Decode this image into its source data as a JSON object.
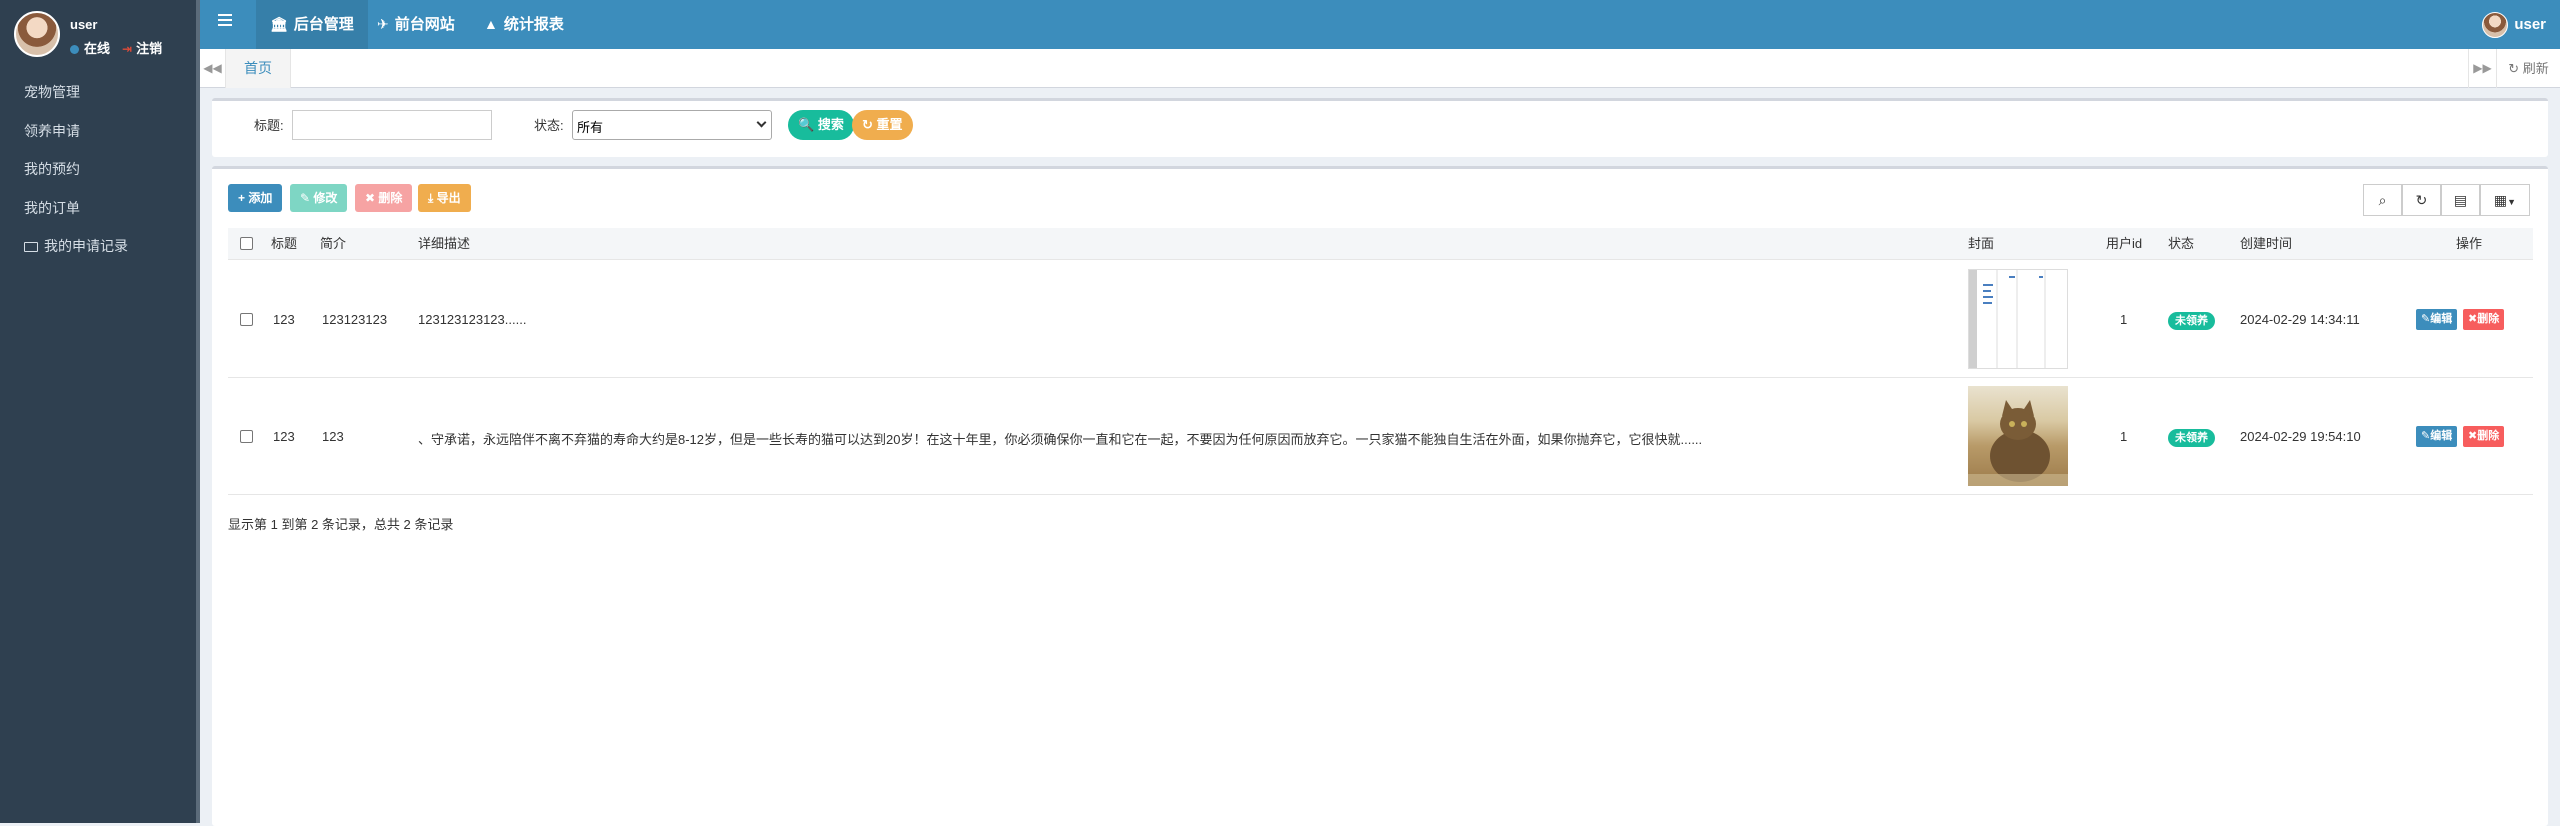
{
  "sidebar": {
    "user_name": "user",
    "online_label": "在线",
    "logout_label": "注销",
    "items": [
      {
        "label": "宠物管理"
      },
      {
        "label": "领养申请"
      },
      {
        "label": "我的预约"
      },
      {
        "label": "我的订单"
      },
      {
        "label": "我的申请记录"
      }
    ]
  },
  "topbar": {
    "nav": [
      {
        "label": "后台管理",
        "icon": "bank-icon"
      },
      {
        "label": "前台网站",
        "icon": "paper-plane-icon"
      },
      {
        "label": "统计报表",
        "icon": "area-chart-icon"
      }
    ],
    "user_name": "user"
  },
  "tabs": {
    "home": "首页",
    "refresh": "刷新"
  },
  "search": {
    "title_label": "标题:",
    "title_value": "",
    "status_label": "状态:",
    "status_value": "所有",
    "search_btn": "搜索",
    "reset_btn": "重置"
  },
  "toolbar": {
    "add": "添加",
    "edit": "修改",
    "delete": "删除",
    "export": "导出"
  },
  "table": {
    "columns": [
      "标题",
      "简介",
      "详细描述",
      "封面",
      "用户id",
      "状态",
      "创建时间",
      "操作"
    ],
    "rows": [
      {
        "title": "123",
        "intro": "123123123",
        "detail": "123123123123......",
        "user_id": "1",
        "status": "未领养",
        "created": "2024-02-29 14:34:11",
        "edit": "编辑",
        "delete": "删除"
      },
      {
        "title": "123",
        "intro": "123",
        "detail": "、守承诺，永远陪伴不离不弃猫的寿命大约是8-12岁，但是一些长寿的猫可以达到20岁！在这十年里，你必须确保你一直和它在一起，不要因为任何原因而放弃它。一只家猫不能独自生活在外面，如果你抛弃它，它很快就......",
        "user_id": "1",
        "status": "未领养",
        "created": "2024-02-29 19:54:10",
        "edit": "编辑",
        "delete": "删除"
      }
    ],
    "footer": "显示第 1 到第 2 条记录，总共 2 条记录"
  },
  "colors": {
    "primary": "#3c8dbc",
    "sidebar": "#2f4050",
    "success": "#18bc9c",
    "danger": "#f75d5d",
    "warning": "#f39c12"
  }
}
